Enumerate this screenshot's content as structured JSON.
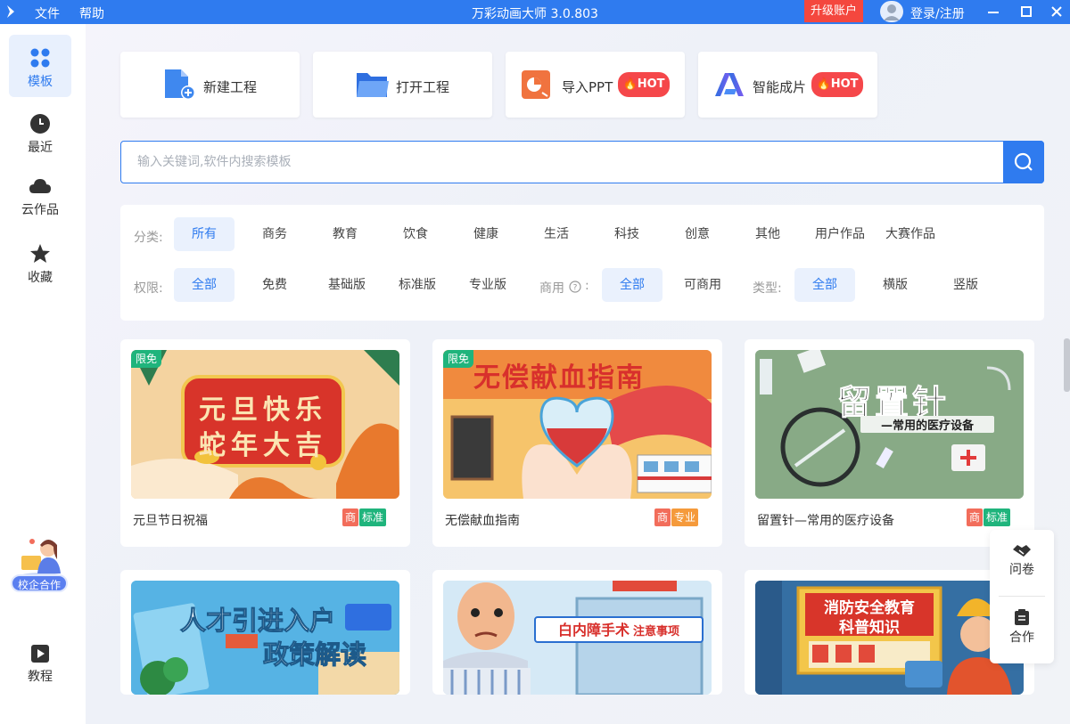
{
  "titlebar": {
    "menu": [
      "文件",
      "帮助"
    ],
    "title": "万彩动画大师 3.0.803",
    "upgrade": "升级账户",
    "login": "登录/注册"
  },
  "sidebar": {
    "items": [
      {
        "label": "模板",
        "icon": "grid-icon",
        "active": true
      },
      {
        "label": "最近",
        "icon": "clock-icon"
      },
      {
        "label": "云作品",
        "icon": "cloud-icon"
      },
      {
        "label": "收藏",
        "icon": "star-icon"
      }
    ],
    "cooperation": "校企合作",
    "tutorial": "教程"
  },
  "quick_actions": [
    {
      "label": "新建工程",
      "icon": "new-file-icon"
    },
    {
      "label": "打开工程",
      "icon": "folder-icon"
    },
    {
      "label": "导入PPT",
      "icon": "ppt-icon",
      "badge": "HOT"
    },
    {
      "label": "智能成片",
      "icon": "ai-logo-icon",
      "badge": "HOT"
    }
  ],
  "search": {
    "placeholder": "输入关键词,软件内搜索模板"
  },
  "filters": {
    "category_label": "分类:",
    "categories": [
      "所有",
      "商务",
      "教育",
      "饮食",
      "健康",
      "生活",
      "科技",
      "创意",
      "其他",
      "用户作品",
      "大赛作品"
    ],
    "permission_label": "权限:",
    "permissions": [
      "全部",
      "免费",
      "基础版",
      "标准版",
      "专业版"
    ],
    "commercial_label": "商用",
    "commercial_colon": ":",
    "commercial": [
      "全部",
      "可商用"
    ],
    "type_label": "类型:",
    "types": [
      "全部",
      "横版",
      "竖版"
    ]
  },
  "templates": [
    {
      "title": "元旦节日祝福",
      "free_tag": "限免",
      "thumb_text": [
        "元旦快乐",
        "蛇年大吉"
      ],
      "badges": [
        "商",
        "标准"
      ]
    },
    {
      "title": "无偿献血指南",
      "free_tag": "限免",
      "thumb_text": [
        "无偿献血指南"
      ],
      "badges": [
        "商",
        "专业"
      ]
    },
    {
      "title": "留置针—常用的医疗设备",
      "thumb_text": [
        "留置针",
        "—常用的医疗设备"
      ],
      "badges": [
        "商",
        "标准"
      ]
    },
    {
      "thumb_text": [
        "人才引进入户",
        "政策解读"
      ]
    },
    {
      "thumb_text": [
        "白内障手术",
        "注意事项"
      ]
    },
    {
      "thumb_text": [
        "消防安全教育",
        "科普知识"
      ]
    }
  ],
  "float_panel": {
    "survey": "问卷",
    "cooperate": "合作"
  },
  "colors": {
    "primary": "#2f7bef",
    "hot": "#f5474a",
    "upgrade": "#f4473e",
    "standard": "#1fb47c",
    "commercial": "#f26d5b",
    "pro": "#f59a3b"
  }
}
